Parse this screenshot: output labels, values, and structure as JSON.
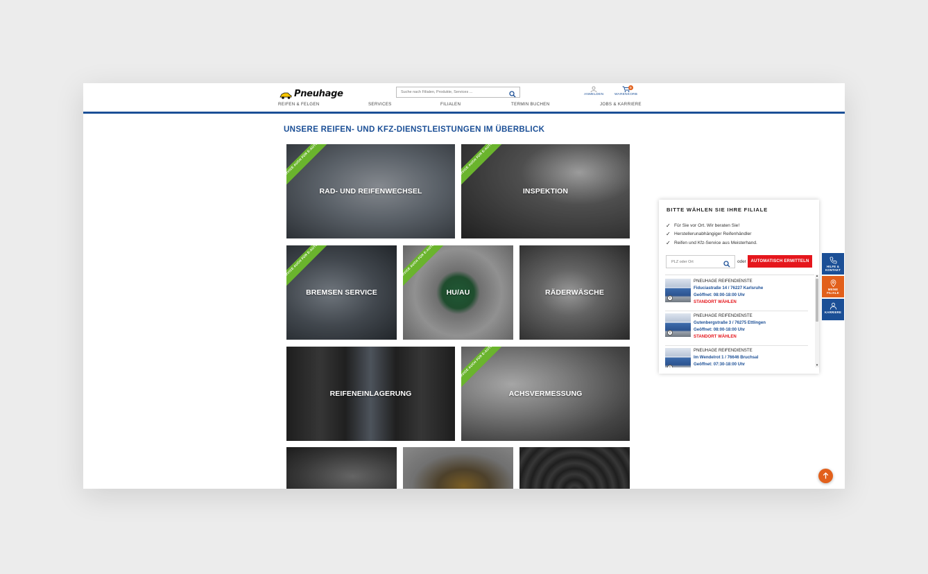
{
  "header": {
    "logo_text": "Pneuhage",
    "search_placeholder": "Suche nach Filialen, Produkte, Services ...",
    "login_label": "ANMELDEN",
    "cart_label": "WARENKORB",
    "cart_count": "0",
    "nav": [
      "REIFEN & FELGEN",
      "SERVICES",
      "FILIALEN",
      "TERMIN BUCHEN",
      "JOBS & KARRIERE"
    ]
  },
  "page_title": "UNSERE REIFEN- UND KFZ-DIENSTLEISTUNGEN IM ÜBERBLICK",
  "ribbon_text": "SERVICE AUCH FÜR E-AUTOS",
  "tiles": [
    {
      "label": "RAD- UND REIFENWECHSEL",
      "ribbon": true
    },
    {
      "label": "INSPEKTION",
      "ribbon": true
    },
    {
      "label": "BREMSEN SERVICE",
      "ribbon": true
    },
    {
      "label": "HU/AU",
      "ribbon": true
    },
    {
      "label": "RÄDERWÄSCHE",
      "ribbon": false
    },
    {
      "label": "REIFENEINLAGERUNG",
      "ribbon": false
    },
    {
      "label": "ACHSVERMESSUNG",
      "ribbon": true
    },
    {
      "label": "",
      "ribbon": false
    },
    {
      "label": "",
      "ribbon": false
    },
    {
      "label": "",
      "ribbon": false
    }
  ],
  "filial": {
    "title": "BITTE WÄHLEN SIE IHRE FILIALE",
    "checks": [
      "Für Sie vor Ort. Wir beraten Sie!",
      "Herstellerunabhängiger Reifenhändler",
      "Reifen und Kfz-Service aus Meisterhand."
    ],
    "plz_placeholder": "PLZ oder Ort",
    "oder": "oder",
    "auto_button": "AUTOMATISCH ERMITTELN",
    "entries": [
      {
        "name": "PNEUHAGE REIFENDIENSTE",
        "address": "Fiduciastraße 14 / 76227 Karlsruhe",
        "hours": "Geöffnet: 08:00-18:00 Uhr",
        "action": "STANDORT WÄHLEN"
      },
      {
        "name": "PNEUHAGE REIFENDIENSTE",
        "address": "Gutenbergstraße 3 / 76275 Ettlingen",
        "hours": "Geöffnet: 08:00-18:00 Uhr",
        "action": "STANDORT WÄHLEN"
      },
      {
        "name": "PNEUHAGE REIFENDIENSTE",
        "address": "Im Wendelrot 1 / 76646 Bruchsal",
        "hours": "Geöffnet: 07:30-18:00 Uhr",
        "action": ""
      }
    ]
  },
  "side_buttons": [
    {
      "label": "HILFE & KONTAKT",
      "icon": "phone-icon",
      "color": "#1b4f96"
    },
    {
      "label": "MEINE FILIALE",
      "icon": "location-pin-icon",
      "color": "#e2601b"
    },
    {
      "label": "KARRIERE",
      "icon": "person-icon",
      "color": "#1b4f96"
    }
  ],
  "colors": {
    "brand_blue": "#1b4f96",
    "accent_orange": "#e2601b",
    "ribbon_green": "#6ab42d",
    "action_red": "#e5161c"
  }
}
